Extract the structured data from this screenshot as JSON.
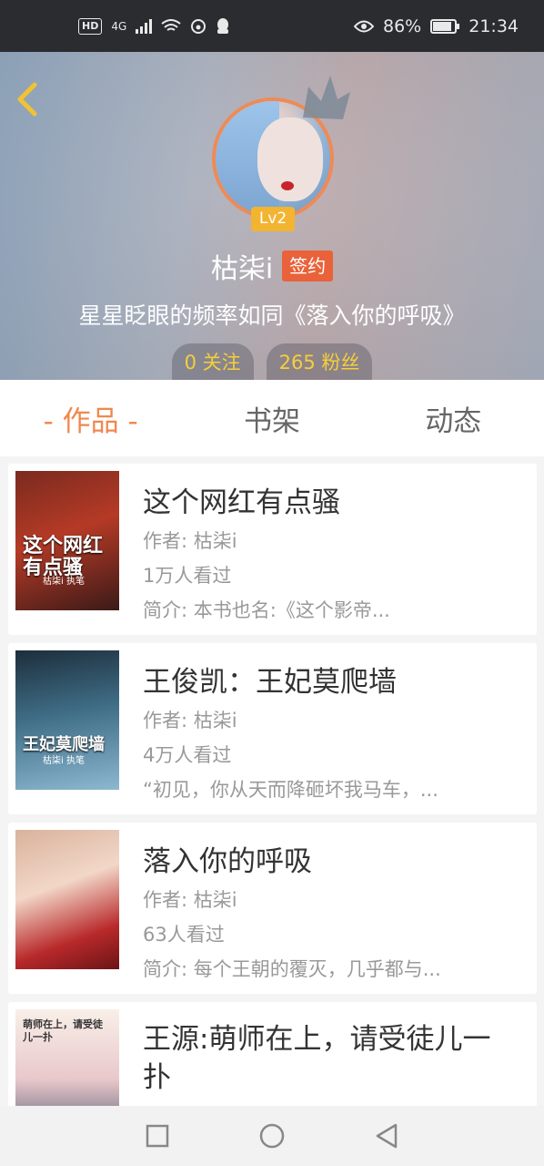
{
  "status_bar": {
    "hd": "HD",
    "network": "4G",
    "battery_percent": "86%",
    "time": "21:34"
  },
  "profile": {
    "level": "Lv2",
    "username": "枯柒i",
    "sign_badge": "签约",
    "bio": "星星眨眼的频率如同《落入你的呼吸》",
    "following": "0 关注",
    "fans": "265 粉丝"
  },
  "tabs": [
    {
      "label": "- 作品 -",
      "active": true
    },
    {
      "label": "书架",
      "active": false
    },
    {
      "label": "动态",
      "active": false
    }
  ],
  "books": [
    {
      "title": "这个网红有点骚",
      "author": "作者: 枯柒i",
      "views": "1万人看过",
      "intro": "简介: 本书也名:《这个影帝..."
    },
    {
      "title": "王俊凯：王妃莫爬墙",
      "author": "作者: 枯柒i",
      "views": "4万人看过",
      "intro": "“初见，你从天而降砸坏我马车，..."
    },
    {
      "title": "落入你的呼吸",
      "author": "作者: 枯柒i",
      "views": "63人看过",
      "intro": "简介: 每个王朝的覆灭，几乎都与..."
    },
    {
      "title": "王源:萌师在上，请受徒儿一扑",
      "author": "",
      "views": "",
      "intro": ""
    }
  ],
  "covers": {
    "cover_1_text": "这个网红有点骚",
    "cover_1_sub": "枯柒i 执笔",
    "cover_2_text": "王妃莫爬墙",
    "cover_2_sub": "枯柒i 执笔",
    "cover_4_text": "萌师在上，请受徒儿一扑"
  },
  "colors": {
    "accent": "#f0884e",
    "sign_badge": "#e9623a",
    "level_badge": "#f2b431",
    "stat_text": "#f6cf3a"
  }
}
